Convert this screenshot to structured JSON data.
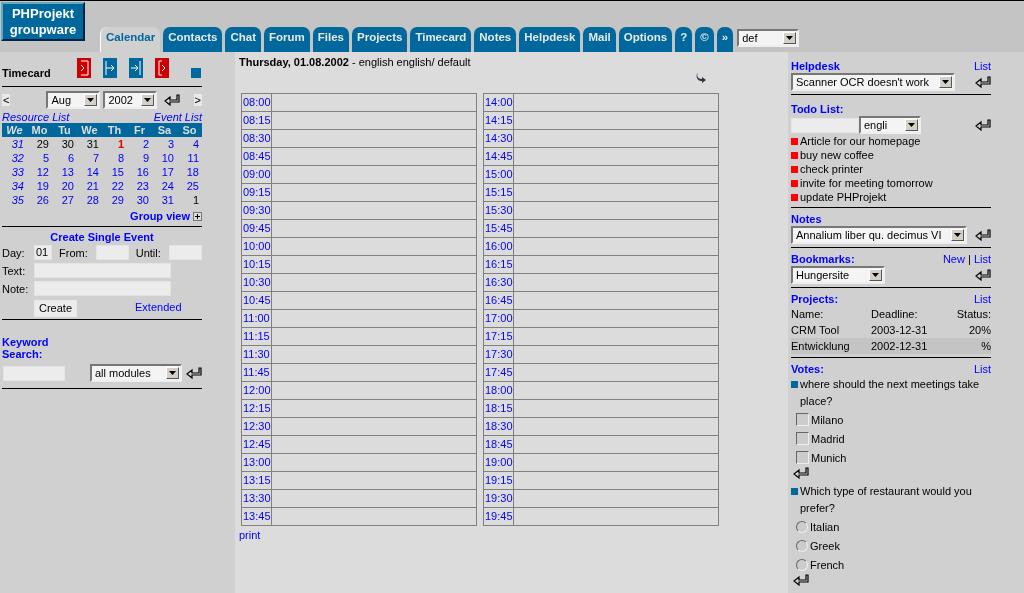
{
  "logo": {
    "lines": [
      "PHProjekt",
      "groupware"
    ]
  },
  "tabs": [
    {
      "label": "Calendar",
      "selected": true
    },
    {
      "label": "Contacts",
      "selected": false
    },
    {
      "label": "Chat",
      "selected": false
    },
    {
      "label": "Forum",
      "selected": false
    },
    {
      "label": "Files",
      "selected": false
    },
    {
      "label": "Projects",
      "selected": false
    },
    {
      "label": "Timecard",
      "selected": false
    },
    {
      "label": "Notes",
      "selected": false
    },
    {
      "label": "Helpdesk",
      "selected": false
    },
    {
      "label": "Mail",
      "selected": false
    },
    {
      "label": "Options",
      "selected": false
    },
    {
      "label": "?",
      "selected": false
    },
    {
      "label": "©",
      "selected": false
    },
    {
      "label": "»",
      "selected": false
    }
  ],
  "profile_select": {
    "value": "def"
  },
  "timecard": {
    "title": "Timecard"
  },
  "calendar": {
    "month": "Aug",
    "year": "2002",
    "prev": "<",
    "next": ">",
    "resource_link": "Resource List",
    "event_link": "Event List",
    "headers": [
      "We",
      "Mo",
      "Tu",
      "We",
      "Th",
      "Fr",
      "Sa",
      "So"
    ],
    "weeks": [
      {
        "week": "31",
        "days": [
          {
            "label": "29",
            "kind": "other"
          },
          {
            "label": "30",
            "kind": "other"
          },
          {
            "label": "31",
            "kind": "other"
          },
          {
            "label": "1",
            "kind": "today"
          },
          {
            "label": "2",
            "kind": "current"
          },
          {
            "label": "3",
            "kind": "current"
          },
          {
            "label": "4",
            "kind": "current"
          }
        ]
      },
      {
        "week": "32",
        "days": [
          {
            "label": "5",
            "kind": "current"
          },
          {
            "label": "6",
            "kind": "current"
          },
          {
            "label": "7",
            "kind": "current"
          },
          {
            "label": "8",
            "kind": "current"
          },
          {
            "label": "9",
            "kind": "current"
          },
          {
            "label": "10",
            "kind": "current"
          },
          {
            "label": "11",
            "kind": "current"
          }
        ]
      },
      {
        "week": "33",
        "days": [
          {
            "label": "12",
            "kind": "current"
          },
          {
            "label": "13",
            "kind": "current"
          },
          {
            "label": "14",
            "kind": "current"
          },
          {
            "label": "15",
            "kind": "current"
          },
          {
            "label": "16",
            "kind": "current"
          },
          {
            "label": "17",
            "kind": "current"
          },
          {
            "label": "18",
            "kind": "current"
          }
        ]
      },
      {
        "week": "34",
        "days": [
          {
            "label": "19",
            "kind": "current"
          },
          {
            "label": "20",
            "kind": "current"
          },
          {
            "label": "21",
            "kind": "current"
          },
          {
            "label": "22",
            "kind": "current"
          },
          {
            "label": "23",
            "kind": "current"
          },
          {
            "label": "24",
            "kind": "current"
          },
          {
            "label": "25",
            "kind": "current"
          }
        ]
      },
      {
        "week": "35",
        "days": [
          {
            "label": "26",
            "kind": "current"
          },
          {
            "label": "27",
            "kind": "current"
          },
          {
            "label": "28",
            "kind": "current"
          },
          {
            "label": "29",
            "kind": "current"
          },
          {
            "label": "30",
            "kind": "current"
          },
          {
            "label": "31",
            "kind": "current"
          },
          {
            "label": "1",
            "kind": "other"
          }
        ]
      }
    ],
    "group_view": "Group view"
  },
  "create_event": {
    "title": "Create Single Event",
    "day_label": "Day:",
    "day_value": "01",
    "from_label": "From:",
    "until_label": "Until:",
    "text_label": "Text:",
    "note_label": "Note:",
    "create_button": "Create",
    "extended_link": "Extended"
  },
  "keyword_search": {
    "title_lines": [
      "Keyword",
      "Search:"
    ],
    "module_select": "all modules"
  },
  "day_view": {
    "date": "Thursday, 01.08.2002",
    "subtitle": "- english english/ default",
    "columns": [
      [
        "08:00",
        "08:15",
        "08:30",
        "08:45",
        "09:00",
        "09:15",
        "09:30",
        "09:45",
        "10:00",
        "10:15",
        "10:30",
        "10:45",
        "11:00",
        "11:15",
        "11:30",
        "11:45",
        "12:00",
        "12:15",
        "12:30",
        "12:45",
        "13:00",
        "13:15",
        "13:30",
        "13:45"
      ],
      [
        "14:00",
        "14:15",
        "14:30",
        "14:45",
        "15:00",
        "15:15",
        "15:30",
        "15:45",
        "16:00",
        "16:15",
        "16:30",
        "16:45",
        "17:00",
        "17:15",
        "17:30",
        "17:45",
        "18:00",
        "18:15",
        "18:30",
        "18:45",
        "19:00",
        "19:15",
        "19:30",
        "19:45"
      ]
    ],
    "print_link": "print"
  },
  "helpdesk": {
    "title": "Helpdesk",
    "list_link": "List",
    "select": "Scanner OCR doesn't work"
  },
  "todo": {
    "title": "Todo List:",
    "language_select": "engli",
    "items": [
      "Article for our homepage",
      "buy new coffee",
      "check printer",
      "invite for meeting tomorrow",
      "update PHProjekt"
    ]
  },
  "notes": {
    "title": "Notes",
    "select": "Annalium liber qu. decimus VI"
  },
  "bookmarks": {
    "title": "Bookmarks:",
    "new_link": "New",
    "separator": "|",
    "list_link": "List",
    "select": "Hungersite"
  },
  "projects": {
    "title": "Projects:",
    "list_link": "List",
    "headers": [
      "Name:",
      "Deadline:",
      "Status:"
    ],
    "rows": [
      {
        "name": "CRM Tool",
        "deadline": "2003-12-31",
        "status": "20%",
        "selected": false
      },
      {
        "name": "Entwicklung",
        "deadline": "2002-12-31",
        "status": "%",
        "selected": true
      }
    ]
  },
  "votes": {
    "title": "Votes:",
    "list_link": "List",
    "polls": [
      {
        "question": "where should the next meetings take place?",
        "kind": "checkbox",
        "options": [
          {
            "label": "Milano",
            "checked": false
          },
          {
            "label": "Madrid",
            "checked": false
          },
          {
            "label": "Munich",
            "checked": false
          }
        ]
      },
      {
        "question": "Which type of restaurant would you prefer?",
        "kind": "radio",
        "options": [
          {
            "label": "Italian",
            "checked": false
          },
          {
            "label": "Greek",
            "checked": false
          },
          {
            "label": "French",
            "checked": false
          }
        ]
      }
    ]
  }
}
